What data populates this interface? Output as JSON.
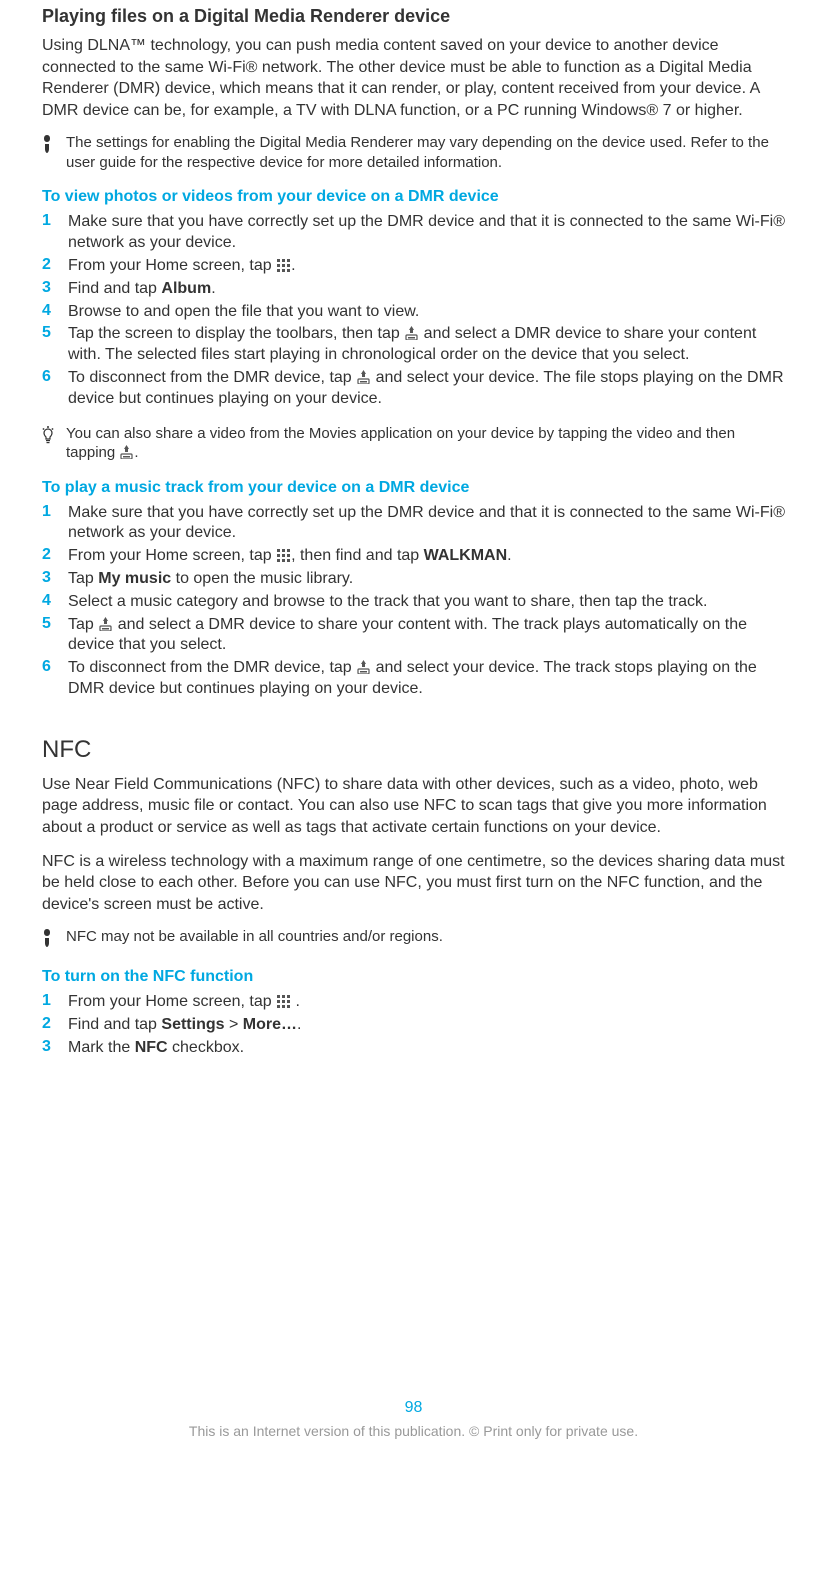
{
  "section1": {
    "heading": "Playing files on a Digital Media Renderer device",
    "body": "Using DLNA™ technology, you can push media content saved on your device to another device connected to the same Wi-Fi® network. The other device must be able to function as a Digital Media Renderer (DMR) device, which means that it can render, or play, content received from your device. A DMR device can be, for example, a TV with DLNA function, or a PC running Windows® 7 or higher.",
    "note1": "The settings for enabling the Digital Media Renderer may vary depending on the device used. Refer to the user guide for the respective device for more detailed information."
  },
  "proc1": {
    "heading": "To view photos or videos from your device on a DMR device",
    "steps": {
      "s1": "Make sure that you have correctly set up the DMR device and that it is connected to the same Wi-Fi® network as your device.",
      "s2a": "From your Home screen, tap ",
      "s2b": ".",
      "s3a": "Find and tap ",
      "s3bold": "Album",
      "s3b": ".",
      "s4": "Browse to and open the file that you want to view.",
      "s5a": "Tap the screen to display the toolbars, then tap ",
      "s5b": " and select a DMR device to share your content with. The selected files start playing in chronological order on the device that you select.",
      "s6a": "To disconnect from the DMR device, tap ",
      "s6b": " and select your device. The file stops playing on the DMR device but continues playing on your device."
    },
    "tip_a": "You can also share a video from the Movies application on your device by tapping the video and then tapping ",
    "tip_b": "."
  },
  "proc2": {
    "heading": "To play a music track from your device on a DMR device",
    "steps": {
      "s1": "Make sure that you have correctly set up the DMR device and that it is connected to the same Wi-Fi® network as your device.",
      "s2a": "From your Home screen, tap ",
      "s2b": ", then find and tap ",
      "s2bold": "WALKMAN",
      "s2c": ".",
      "s3a": "Tap ",
      "s3bold": "My music",
      "s3b": " to open the music library.",
      "s4": "Select a music category and browse to the track that you want to share, then tap the track.",
      "s5a": "Tap ",
      "s5b": " and select a DMR device to share your content with. The track plays automatically on the device that you select.",
      "s6a": "To disconnect from the DMR device, tap ",
      "s6b": " and select your device. The track stops playing on the DMR device but continues playing on your device."
    }
  },
  "section2": {
    "heading": "NFC",
    "body1": "Use Near Field Communications (NFC) to share data with other devices, such as a video, photo, web page address, music file or contact. You can also use NFC to scan tags that give you more information about a product or service as well as tags that activate certain functions on your device.",
    "body2": "NFC is a wireless technology with a maximum range of one centimetre, so the devices sharing data must be held close to each other. Before you can use NFC, you must first turn on the NFC function, and the device's screen must be active.",
    "note": "NFC may not be available in all countries and/or regions."
  },
  "proc3": {
    "heading": "To turn on the NFC function",
    "steps": {
      "s1a": "From your Home screen, tap ",
      "s1b": " .",
      "s2a": "Find and tap ",
      "s2bold1": "Settings",
      "s2mid": " > ",
      "s2bold2": "More…",
      "s2b": ".",
      "s3a": "Mark the ",
      "s3bold": "NFC",
      "s3b": " checkbox."
    }
  },
  "page_number": "98",
  "footer": "This is an Internet version of this publication. © Print only for private use."
}
